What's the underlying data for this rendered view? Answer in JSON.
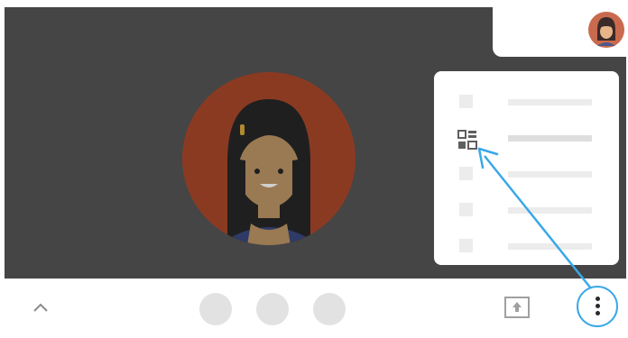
{
  "colors": {
    "video_background": "#454545",
    "toolbar_background": "#ffffff",
    "menu_background": "#ffffff",
    "placeholder_gray": "#ececec",
    "annotation_blue": "#3aa8e8",
    "avatar_ring": "#8b3a22"
  },
  "video": {
    "main_participant": {
      "icon": "person-avatar-icon"
    },
    "self_view": {
      "icon": "person-avatar-icon"
    }
  },
  "menu": {
    "items": [
      {
        "icon": "placeholder-icon",
        "active": false
      },
      {
        "icon": "qr-code-icon",
        "active": true
      },
      {
        "icon": "placeholder-icon",
        "active": false
      },
      {
        "icon": "placeholder-icon",
        "active": false
      },
      {
        "icon": "placeholder-icon",
        "active": false
      }
    ]
  },
  "toolbar": {
    "left": {
      "icon": "chevron-up-icon"
    },
    "center_controls": [
      "placeholder-button",
      "placeholder-button",
      "placeholder-button"
    ],
    "present": {
      "icon": "present-screen-icon"
    },
    "more": {
      "icon": "more-vert-icon",
      "highlighted": true
    }
  },
  "annotation": {
    "type": "arrow",
    "from": "more-options-button",
    "to": "menu-item-qr-code"
  }
}
